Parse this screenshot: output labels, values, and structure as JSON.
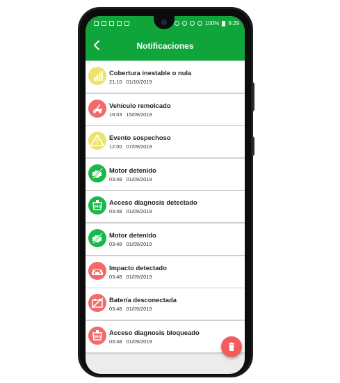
{
  "colors": {
    "header": "#10a53a",
    "yellow": "#ece56a",
    "red": "#f26a6a",
    "green": "#19b84a",
    "fab": "#f25c5c"
  },
  "status_bar": {
    "battery": "100%",
    "time": "9:29"
  },
  "header": {
    "title": "Notificaciones",
    "back_icon": "chevron-left-icon"
  },
  "notifications": [
    {
      "title": "Cobertura inestable o nula",
      "time": "21:10",
      "date": "01/10/2019",
      "icon": "signal-bars-icon",
      "color": "yellow"
    },
    {
      "title": "Vehículo remolcado",
      "time": "16:03",
      "date": "15/09/2019",
      "icon": "tow-truck-icon",
      "color": "red"
    },
    {
      "title": "Evento sospechoso",
      "time": "12:00",
      "date": "07/09/2019",
      "icon": "warning-icon",
      "color": "yellow"
    },
    {
      "title": "Motor detenido",
      "time": "03:48",
      "date": "01/09/2019",
      "icon": "engine-off-icon",
      "color": "green"
    },
    {
      "title": "Acceso diagnosis detectado",
      "time": "03:48",
      "date": "01/09/2019",
      "icon": "obd-plug-icon",
      "color": "green"
    },
    {
      "title": "Motor detenido",
      "time": "03:48",
      "date": "01/09/2019",
      "icon": "engine-off-icon",
      "color": "green"
    },
    {
      "title": "Impacto detectado",
      "time": "03:48",
      "date": "01/09/2019",
      "icon": "car-crash-icon",
      "color": "red"
    },
    {
      "title": "Batería desconectada",
      "time": "03:48",
      "date": "01/09/2019",
      "icon": "battery-off-icon",
      "color": "red"
    },
    {
      "title": "Acceso diagnosis bloqueado",
      "time": "03:48",
      "date": "01/09/2019",
      "icon": "obd-plug-icon",
      "color": "red"
    }
  ],
  "fab": {
    "icon": "trash-icon"
  }
}
